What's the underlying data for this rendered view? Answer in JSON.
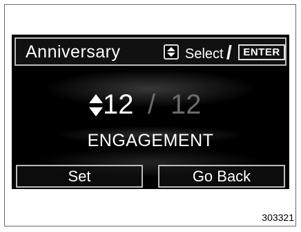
{
  "header": {
    "title": "Anniversary",
    "select_label": "Select",
    "slash": "/",
    "enter_label": "ENTER"
  },
  "value": {
    "current": "12",
    "separator": "/",
    "max": "12"
  },
  "setting_label": "ENGAGEMENT",
  "buttons": {
    "set": "Set",
    "go_back": "Go Back"
  },
  "figure_number": "303321",
  "colors": {
    "screen_background": "#000000",
    "text": "#ffffff",
    "dim_text": "#6b6b6b",
    "border": "#bdbdbd"
  },
  "icons": {
    "select_icon": "up-down-arrow-icon",
    "value_icon": "up-down-arrow-icon"
  }
}
